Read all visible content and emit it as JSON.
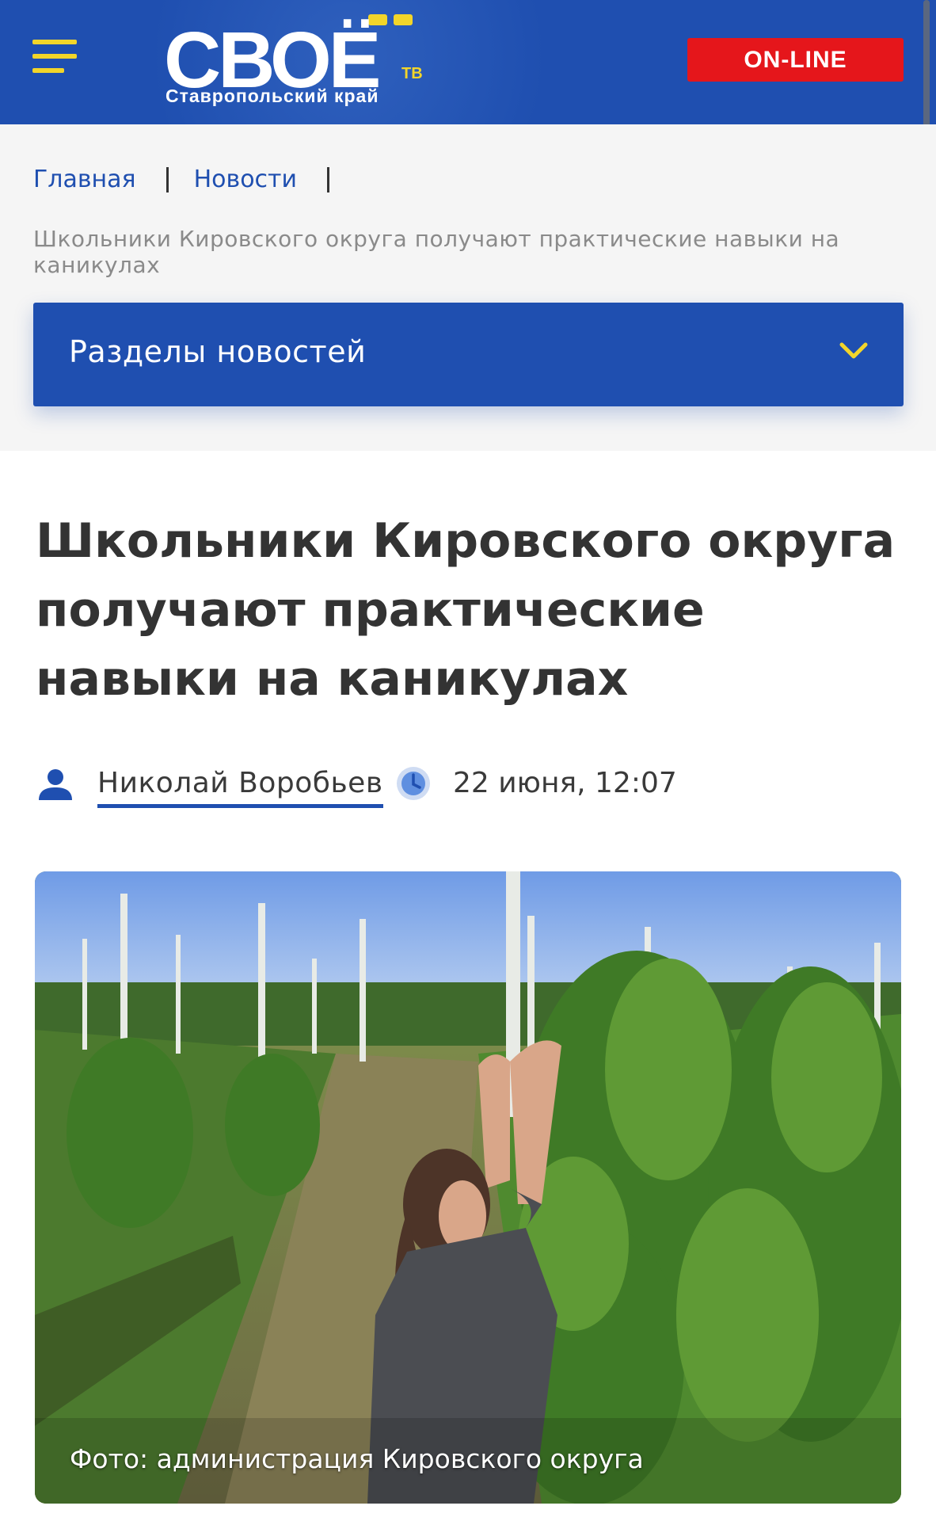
{
  "header": {
    "logo_word": "СВОЁ",
    "logo_tv": "ТВ",
    "logo_sub": "Ставропольский край",
    "online_label": "ON-LINE"
  },
  "breadcrumb": {
    "home": "Главная",
    "news": "Новости",
    "current": "Школьники Кировского округа получают практические навыки на каникулах"
  },
  "sections": {
    "label": "Разделы новостей"
  },
  "article": {
    "title": "Школьники Кировского округа получают практические навыки на каникулах",
    "author": "Николай Воробьев",
    "date": "22 июня, 12:07",
    "photo_caption": "Фото: администрация Кировского округа"
  },
  "colors": {
    "brand_blue": "#1f4fb0",
    "accent_yellow": "#f2d52a",
    "online_red": "#e5161b"
  },
  "icons": {
    "menu": "menu-icon",
    "chevron": "chevron-down-icon",
    "author": "person-icon",
    "date": "clock-icon"
  }
}
